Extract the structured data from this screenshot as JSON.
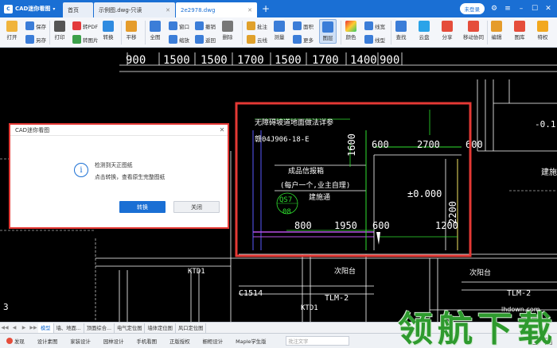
{
  "titlebar": {
    "app_name": "CAD迷你看图",
    "tabs": [
      {
        "label": "首页"
      },
      {
        "label": "示例图.dwg-只读"
      },
      {
        "label": "2e2978.dwg"
      }
    ],
    "login_label": "未登录"
  },
  "ribbon": {
    "open": "打开",
    "save": "保存",
    "save_as": "另存",
    "print": "打印",
    "to_pdf": "转PDF",
    "to_image": "转图片",
    "convert": "转换",
    "pan": "平移",
    "full_view": "全图",
    "window": "窗口",
    "zoom": "缩放",
    "undo": "撤销",
    "redo": "返回",
    "delete": "删除",
    "annotate": "批注",
    "cloud_line": "云线",
    "measure": "测量",
    "area": "面积",
    "more_tools": "更多",
    "layer": "图层",
    "color": "颜色",
    "linewidth": "线宽",
    "linetype": "线型",
    "find": "查找",
    "cloud_disk": "云盘",
    "share": "分享",
    "mobile_sync": "移动协同",
    "edit": "编辑",
    "library": "图库",
    "privilege": "特权"
  },
  "dialog": {
    "title": "CAD迷你看图",
    "line1": "检测到天正图纸",
    "line2": "点击转换，查看原生完整图纸",
    "convert_label": "转换",
    "close_label": "关闭"
  },
  "drawing": {
    "top_dims": [
      "900",
      "1500",
      "1500",
      "1700",
      "1500",
      "1700",
      "1400",
      "900"
    ],
    "note_title": "无障碍坡道地面做法详参",
    "note_ref": "赣04J906-18-E",
    "dim_1600": "1600",
    "dim_600_top": "600",
    "dim_2700": "2700",
    "dim_600_right": "600",
    "room_label": "成品信报箱",
    "room_note": "(每户一个,业主自理)",
    "build_label": "建施通",
    "qs_label": "QS7",
    "qs_num": "08",
    "elev": "±0.000",
    "dim_2200": "2200",
    "dim_800": "800",
    "dim_1950": "1950",
    "dim_600_bottom": "600",
    "dim_1200": "1200",
    "ktd1": "KTD1",
    "ktd1b": "KTD1",
    "balcony": "次阳台",
    "balcony_b": "次阳台",
    "tlm": "TLM-2",
    "tlm_b": "TLM-2",
    "c1514": "C1514",
    "right_1": "-0.1",
    "right_2": "建施",
    "left_3": "3"
  },
  "layout_tabs": [
    "模型",
    "墙、地面...",
    "顶面综合...",
    "电气定位图",
    "墙体定位图",
    "风口定位图"
  ],
  "statusbar": {
    "items": [
      "发现",
      "设计素图",
      "家装设计",
      "园林设计",
      "手机看图",
      "正版授权",
      "橱柜设计",
      "Maple学生版"
    ],
    "search_placeholder": "批注文字"
  },
  "watermark": {
    "text": "领航下载",
    "url": "lhdown.com"
  },
  "colors": {
    "titlebar": "#1a6fd4",
    "highlight": "#e53935",
    "cad_bg": "#000000",
    "accent_yellow": "#f5e663",
    "accent_green": "#2fe12f",
    "accent_purple": "#b84fe6",
    "accent_blue": "#5a5aff"
  }
}
